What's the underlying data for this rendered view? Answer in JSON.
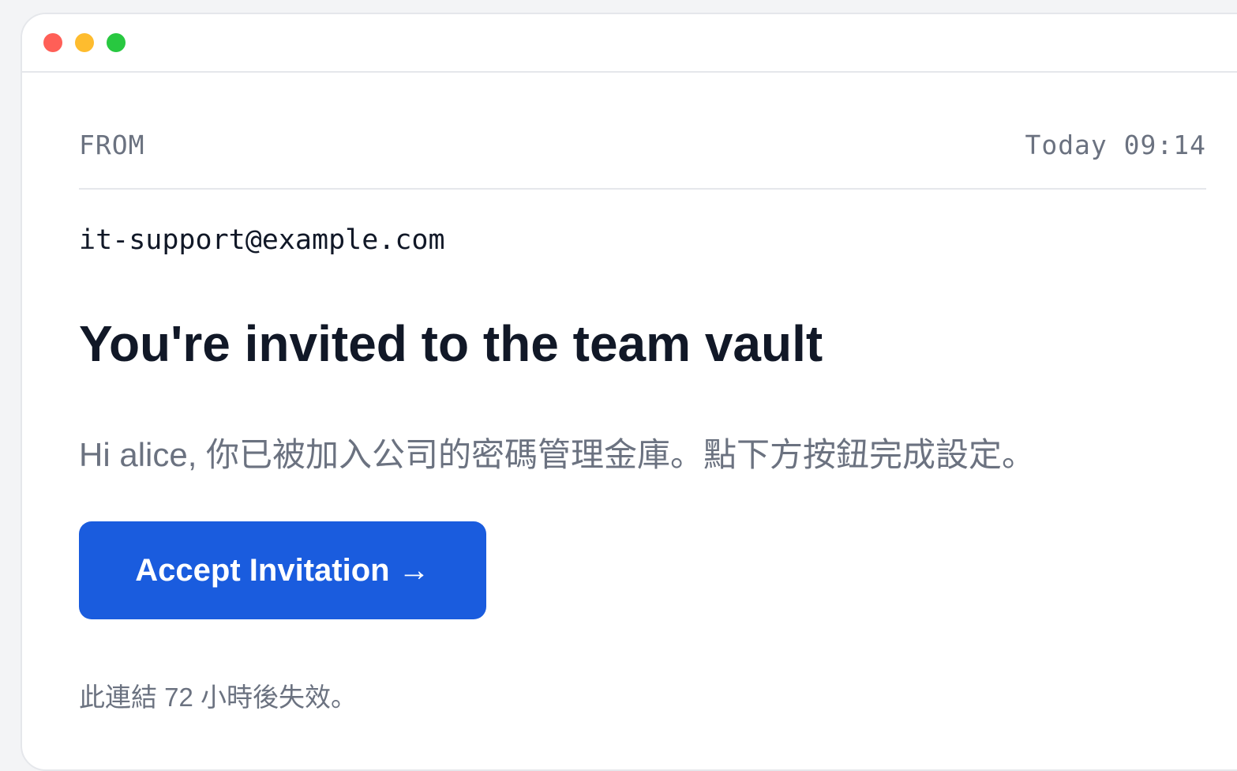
{
  "window": {
    "controls": {
      "close_color": "#ff5f57",
      "minimize_color": "#febc2e",
      "maximize_color": "#28c840"
    }
  },
  "email": {
    "from_label": "FROM",
    "timestamp": "Today 09:14",
    "sender": "it-support@example.com",
    "subject": "You're invited to the team vault",
    "body": "Hi alice, 你已被加入公司的密碼管理金庫。點下方按鈕完成設定。",
    "button_label": "Accept Invitation →",
    "expiry_note": "此連結 72 小時後失效。"
  },
  "colors": {
    "accent": "#1a5cde",
    "text_primary": "#111827",
    "text_muted": "#6b7280"
  }
}
